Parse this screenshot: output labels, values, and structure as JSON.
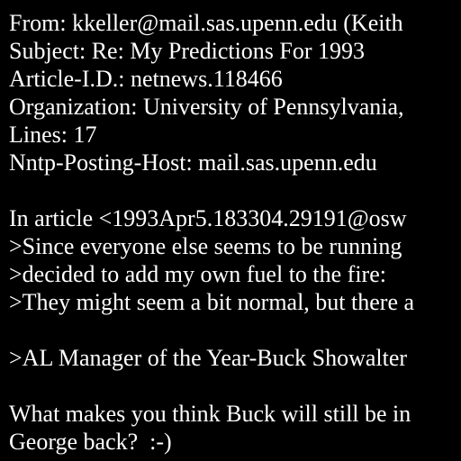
{
  "colors": {
    "background": "#000000",
    "text": "#ffffff"
  },
  "header": {
    "from": "From: kkeller@mail.sas.upenn.edu (Keith",
    "subject": "Subject: Re: My Predictions For 1993",
    "article_id": "Article-I.D.: netnews.118466",
    "organization": "Organization: University of Pennsylvania,",
    "lines": "Lines: 17",
    "nntp_host": "Nntp-Posting-Host: mail.sas.upenn.edu"
  },
  "body": {
    "attribution": "In article <1993Apr5.183304.29191@osw",
    "quote_1": ">Since everyone else seems to be running",
    "quote_2": ">decided to add my own fuel to the fire:",
    "quote_3": ">They might seem a bit normal, but there a",
    "quote_4": ">AL Manager of the Year-Buck Showalter",
    "reply_1": "What makes you think Buck will still be in",
    "reply_2": "George back?  :-)"
  }
}
